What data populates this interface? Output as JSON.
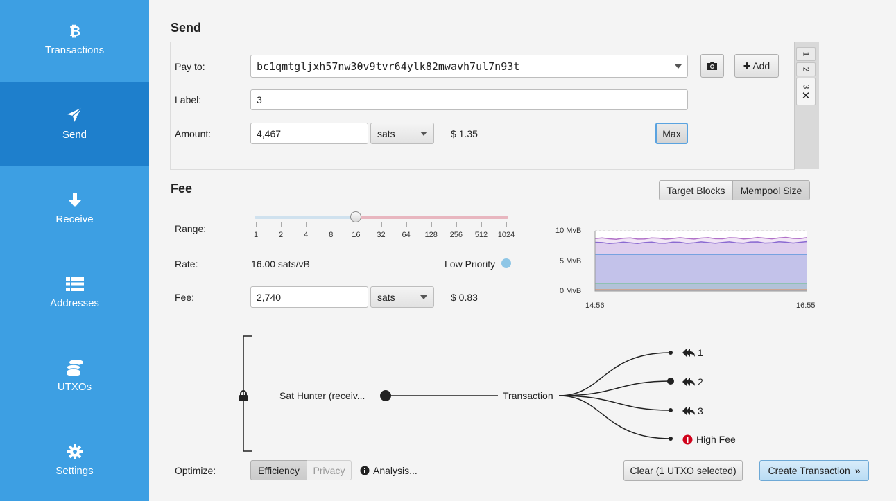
{
  "sidebar": {
    "items": [
      {
        "label": "Transactions",
        "icon": "bitcoin-icon"
      },
      {
        "label": "Send",
        "icon": "paper-plane-icon"
      },
      {
        "label": "Receive",
        "icon": "arrow-down-icon"
      },
      {
        "label": "Addresses",
        "icon": "list-icon"
      },
      {
        "label": "UTXOs",
        "icon": "coins-icon"
      },
      {
        "label": "Settings",
        "icon": "gear-icon"
      }
    ],
    "active": "Send",
    "color": "#3d9fe3",
    "active_color": "#1e7fcc"
  },
  "send": {
    "title": "Send",
    "pay_to_label": "Pay to:",
    "pay_to_value": "bc1qmtgljxh57nw30v9tvr64ylk82mwavh7ul7n93t",
    "label_label": "Label:",
    "label_value": "3",
    "amount_label": "Amount:",
    "amount_value": "4,467",
    "amount_unit": "sats",
    "amount_fiat": "$ 1.35",
    "max_label": "Max",
    "add_label": "Add",
    "tabs": [
      "1",
      "2",
      "3"
    ]
  },
  "fee": {
    "title": "Fee",
    "toggle": [
      "Target Blocks",
      "Mempool Size"
    ],
    "toggle_selected": "Mempool Size",
    "range_label": "Range:",
    "range_ticks": [
      "1",
      "2",
      "4",
      "8",
      "16",
      "32",
      "64",
      "128",
      "256",
      "512",
      "1024"
    ],
    "range_value": "16",
    "rate_label": "Rate:",
    "rate_value": "16.00 sats/vB",
    "priority": "Low Priority",
    "fee_label": "Fee:",
    "fee_value": "2,740",
    "fee_unit": "sats",
    "fee_fiat": "$ 0.83"
  },
  "chart_data": {
    "type": "area",
    "ylabels": [
      "10 MvB",
      "5 MvB",
      "0 MvB"
    ],
    "ylim": [
      0,
      10
    ],
    "xlabels": [
      "14:56",
      "16:55"
    ],
    "series": [
      {
        "color": "#e8884a",
        "values": [
          0.2,
          0.2
        ]
      },
      {
        "color": "#6cc08b",
        "values": [
          1.3,
          1.3
        ]
      },
      {
        "color": "#4a90d9",
        "values": [
          6.1,
          6.1
        ]
      },
      {
        "color": "#8a6ad1",
        "values": [
          8.0,
          8.1
        ]
      },
      {
        "color": "#b070c8",
        "values": [
          8.7,
          8.8
        ]
      }
    ]
  },
  "diagram": {
    "input": "Sat Hunter (receiv...",
    "center": "Transaction",
    "outputs": [
      "1",
      "2",
      "3"
    ],
    "high_fee": "High Fee"
  },
  "footer": {
    "optimize_label": "Optimize:",
    "efficiency": "Efficiency",
    "privacy": "Privacy",
    "analysis": "Analysis...",
    "clear": "Clear (1 UTXO selected)",
    "create": "Create Transaction"
  }
}
